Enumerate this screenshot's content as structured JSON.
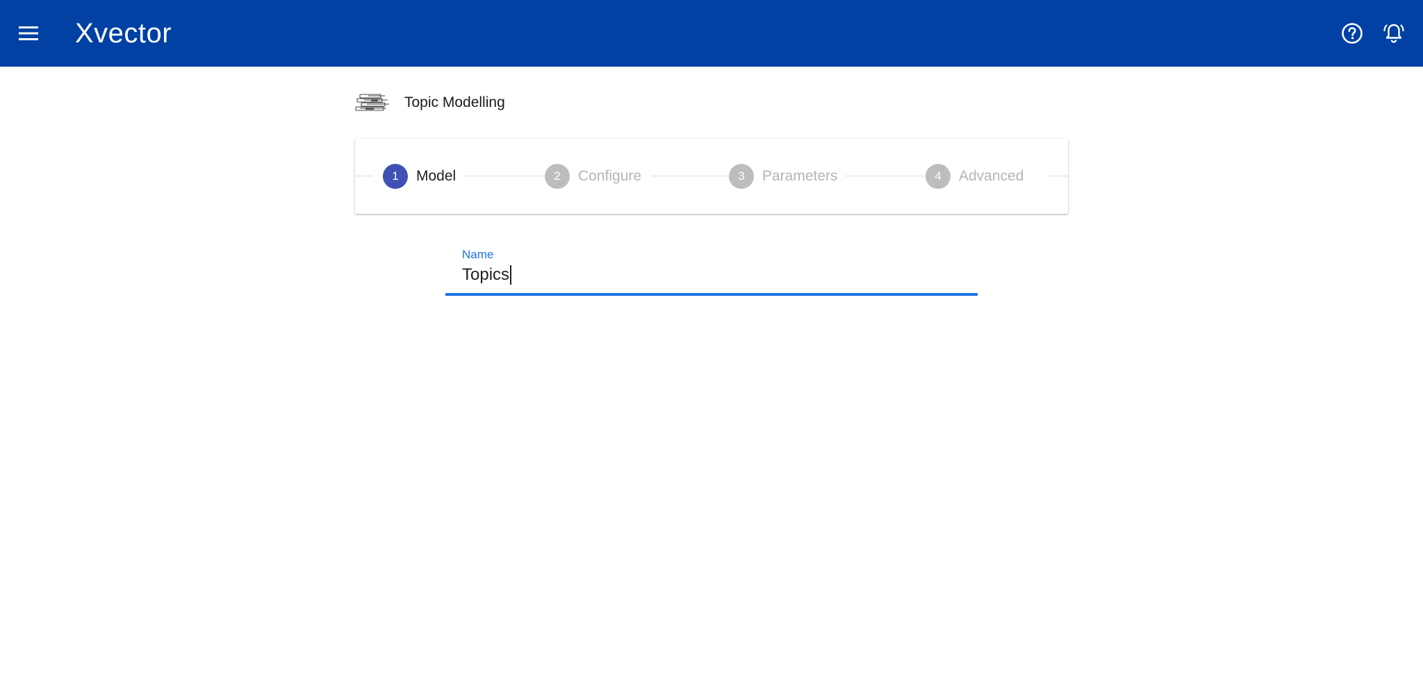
{
  "appbar": {
    "brand": "Xvector",
    "menu_icon": "menu-icon",
    "help_icon": "help-circle-icon",
    "notifications_icon": "bell-icon",
    "background_color": "#0041a3"
  },
  "page": {
    "title": "Topic Modelling",
    "logo_icon": "topic-modelling-logo-icon"
  },
  "stepper": {
    "active_color": "#3f51b5",
    "inactive_color": "#bdbdbd",
    "steps": [
      {
        "number": "1",
        "label": "Model",
        "active": true
      },
      {
        "number": "2",
        "label": "Configure",
        "active": false
      },
      {
        "number": "3",
        "label": "Parameters",
        "active": false
      },
      {
        "number": "4",
        "label": "Advanced",
        "active": false
      }
    ]
  },
  "form": {
    "name_field": {
      "label": "Name",
      "value": "Topics",
      "focused": true,
      "accent_color": "#1a73e8"
    }
  }
}
